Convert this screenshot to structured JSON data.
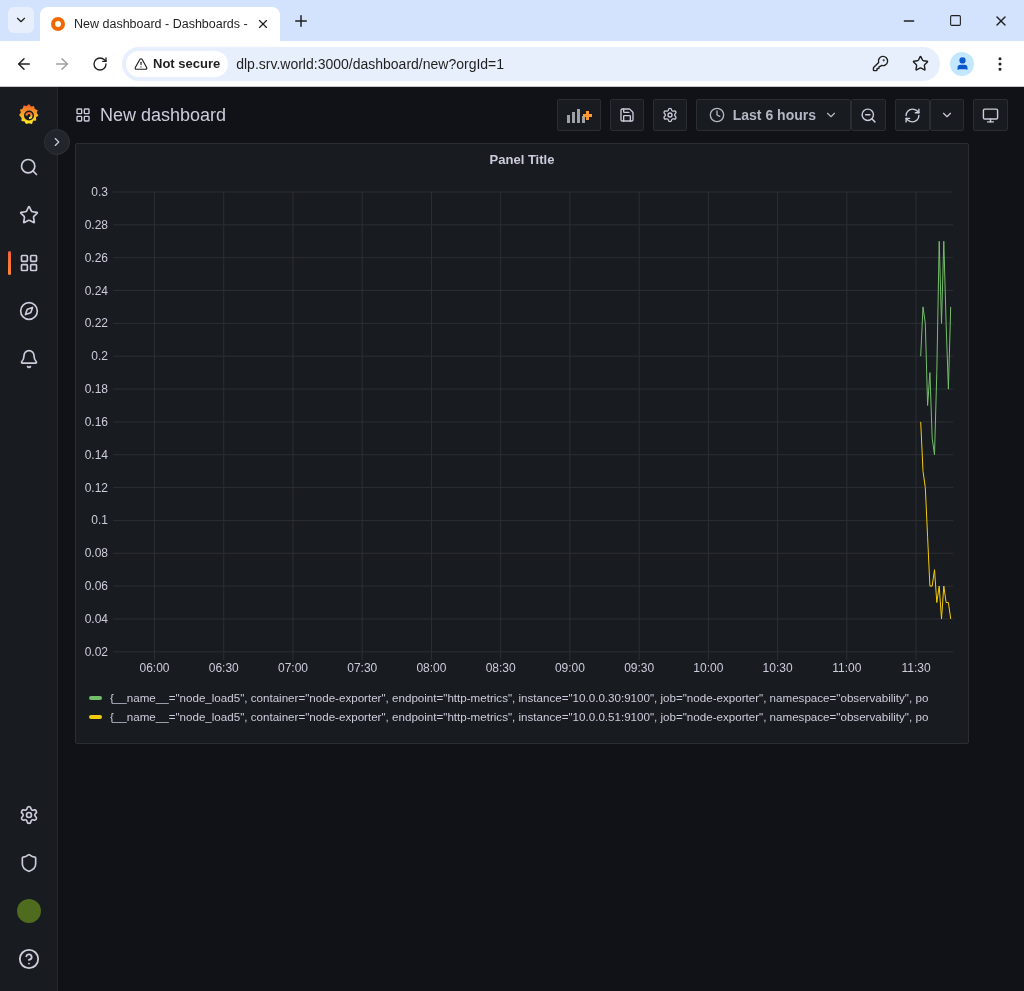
{
  "browser": {
    "tab_title": "New dashboard - Dashboards -",
    "security_label": "Not secure",
    "url": "dlp.srv.world:3000/dashboard/new?orgId=1"
  },
  "sidebar": {
    "items": [
      {
        "selected": false
      },
      {
        "selected": false
      },
      {
        "selected": true
      },
      {
        "selected": false
      },
      {
        "selected": false
      }
    ]
  },
  "header": {
    "title": "New dashboard",
    "time_range": "Last 6 hours"
  },
  "panel": {
    "title": "Panel Title",
    "chart_data": {
      "type": "line",
      "grid": true,
      "x": [
        692,
        693,
        694,
        695,
        696,
        697,
        698,
        699,
        700,
        701,
        702,
        703,
        704,
        705
      ],
      "xlim": [
        342,
        706
      ],
      "ylim": [
        0.015,
        0.3
      ],
      "xticks": [
        {
          "value": 360,
          "label": "06:00"
        },
        {
          "value": 390,
          "label": "06:30"
        },
        {
          "value": 420,
          "label": "07:00"
        },
        {
          "value": 450,
          "label": "07:30"
        },
        {
          "value": 480,
          "label": "08:00"
        },
        {
          "value": 510,
          "label": "08:30"
        },
        {
          "value": 540,
          "label": "09:00"
        },
        {
          "value": 570,
          "label": "09:30"
        },
        {
          "value": 600,
          "label": "10:00"
        },
        {
          "value": 630,
          "label": "10:30"
        },
        {
          "value": 660,
          "label": "11:00"
        },
        {
          "value": 690,
          "label": "11:30"
        }
      ],
      "yticks": [
        0.02,
        0.04,
        0.06,
        0.08,
        0.1,
        0.12,
        0.14,
        0.16,
        0.18,
        0.2,
        0.22,
        0.24,
        0.26,
        0.28,
        0.3
      ],
      "series": [
        {
          "name": "{__name__=\"node_load5\", container=\"node-exporter\", endpoint=\"http-metrics\", instance=\"10.0.0.30:9100\", job=\"node-exporter\", namespace=\"observability\", po",
          "color": "#73bf69",
          "values": [
            0.2,
            0.23,
            0.22,
            0.17,
            0.19,
            0.15,
            0.14,
            0.19,
            0.27,
            0.22,
            0.27,
            0.22,
            0.18,
            0.23
          ]
        },
        {
          "name": "{__name__=\"node_load5\", container=\"node-exporter\", endpoint=\"http-metrics\", instance=\"10.0.0.51:9100\", job=\"node-exporter\", namespace=\"observability\", po",
          "color": "#f2cc0c",
          "values": [
            0.16,
            0.13,
            0.12,
            0.09,
            0.06,
            0.06,
            0.07,
            0.05,
            0.06,
            0.04,
            0.06,
            0.05,
            0.05,
            0.04
          ]
        }
      ]
    }
  }
}
